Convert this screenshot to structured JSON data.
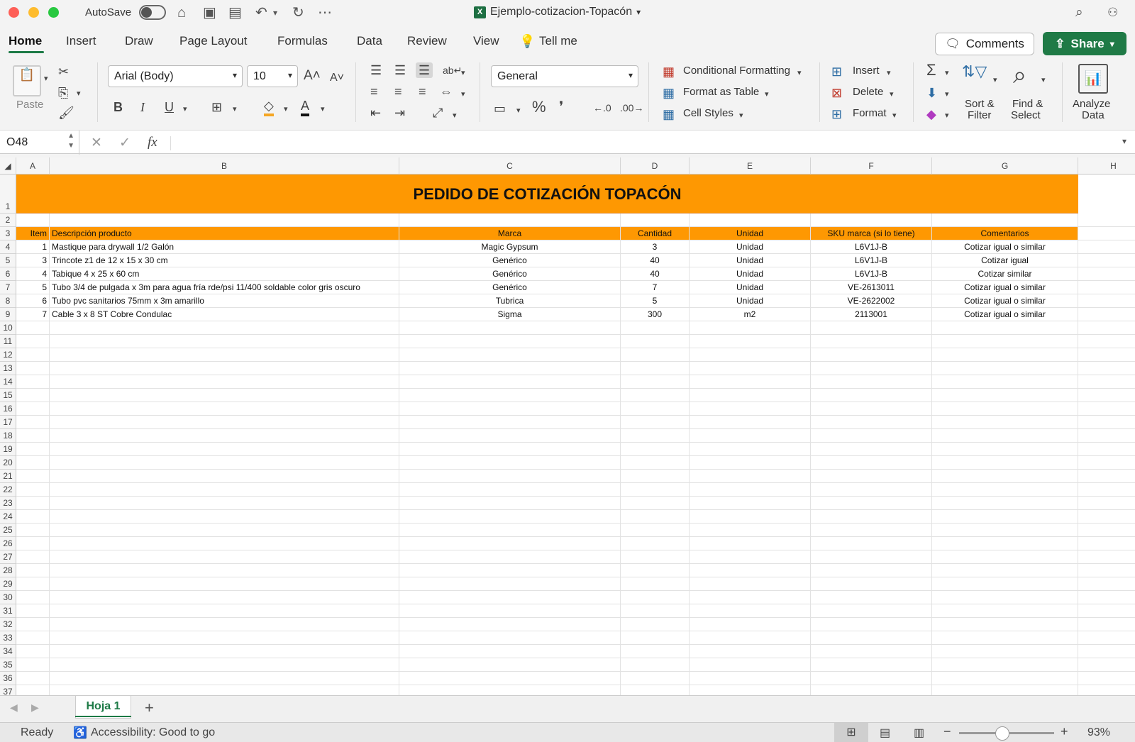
{
  "window": {
    "title": "Ejemplo-cotizacion-Topacón",
    "autosave_label": "AutoSave"
  },
  "menu_tabs": [
    "Home",
    "Insert",
    "Draw",
    "Page Layout",
    "Formulas",
    "Data",
    "Review",
    "View"
  ],
  "tell_me": "Tell me",
  "comments_label": "Comments",
  "share_label": "Share",
  "ribbon": {
    "paste_label": "Paste",
    "font_name": "Arial (Body)",
    "font_size": "10",
    "bold": "B",
    "italic": "I",
    "underline": "U",
    "number_format": "General",
    "percent": "%",
    "comma": "❜",
    "cond_format": "Conditional Formatting",
    "format_table": "Format as Table",
    "cell_styles": "Cell Styles",
    "insert": "Insert",
    "delete": "Delete",
    "format": "Format",
    "sort_filter_1": "Sort &",
    "sort_filter_2": "Filter",
    "find_select_1": "Find &",
    "find_select_2": "Select",
    "analyze_1": "Analyze",
    "analyze_2": "Data"
  },
  "formula_bar": {
    "name_box": "O48",
    "formula": ""
  },
  "columns": [
    "A",
    "B",
    "C",
    "D",
    "E",
    "F",
    "G",
    "H"
  ],
  "sheet": {
    "title": "PEDIDO DE COTIZACIÓN TOPACÓN",
    "headers": [
      "Item",
      "Descripción producto",
      "Marca",
      "Cantidad",
      "Unidad",
      "SKU marca (si lo tiene)",
      "Comentarios"
    ],
    "rows": [
      [
        "1",
        "Mastique para drywall 1/2 Galón",
        "Magic Gypsum",
        "3",
        "Unidad",
        "L6V1J-B",
        "Cotizar igual o similar"
      ],
      [
        "3",
        "Trincote z1 de 12 x 15 x 30 cm",
        "Genérico",
        "40",
        "Unidad",
        "L6V1J-B",
        "Cotizar igual"
      ],
      [
        "4",
        "Tabique 4 x 25 x 60 cm",
        "Genérico",
        "40",
        "Unidad",
        "L6V1J-B",
        "Cotizar similar"
      ],
      [
        "5",
        "Tubo 3/4 de pulgada x 3m para agua fría rde/psi 11/400 soldable color gris oscuro",
        "Genérico",
        "7",
        "Unidad",
        "VE-2613011",
        "Cotizar igual o similar"
      ],
      [
        "6",
        "Tubo pvc sanitarios 75mm x 3m amarillo",
        "Tubrica",
        "5",
        "Unidad",
        "VE-2622002",
        "Cotizar igual o similar"
      ],
      [
        "7",
        "Cable 3 x 8 ST Cobre Condulac",
        "Sigma",
        "300",
        "m2",
        "2113001",
        "Cotizar igual o similar"
      ]
    ]
  },
  "sheet_tabs": [
    {
      "label": "Hoja 1"
    }
  ],
  "add_sheet": "+",
  "status": {
    "ready": "Ready",
    "accessibility": "Accessibility: Good to go",
    "zoom": "93%"
  },
  "colors": {
    "accent": "#1f7a46",
    "header_fill": "#fe9802"
  }
}
